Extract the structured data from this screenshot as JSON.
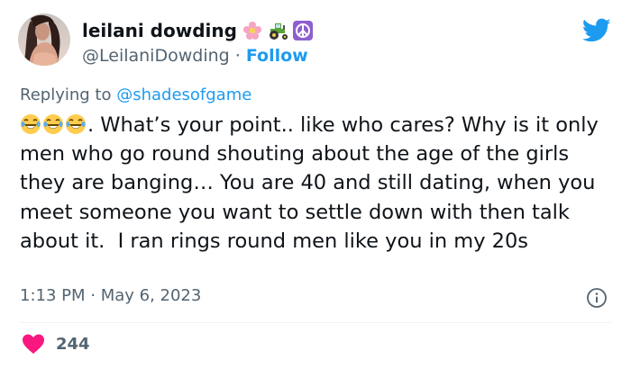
{
  "author": {
    "display_name": "leilani dowding",
    "name_emojis": [
      "flower-icon",
      "tractor-icon",
      "peace-icon"
    ],
    "handle": "@LeilaniDowding",
    "separator": " · ",
    "follow_label": "Follow"
  },
  "reply": {
    "prefix": "Replying to ",
    "mention": "@shadesofgame"
  },
  "tweet": {
    "leading_emojis": [
      "laughing-tears-icon",
      "laughing-tears-icon",
      "laughing-tears-icon"
    ],
    "text": ". What’s your point.. like who cares? Why is it only men who go round shouting about the age of the girls they are banging… You are 40 and still dating, when you meet someone you want to settle down with then talk about it.  I ran rings round men like you in my 20s"
  },
  "meta": {
    "timestamp": "1:13 PM · May 6, 2023"
  },
  "engagement": {
    "like_count": "244"
  },
  "colors": {
    "accent": "#1d9bf0",
    "muted": "#536471",
    "text": "#0f1419",
    "like": "#f91880"
  }
}
